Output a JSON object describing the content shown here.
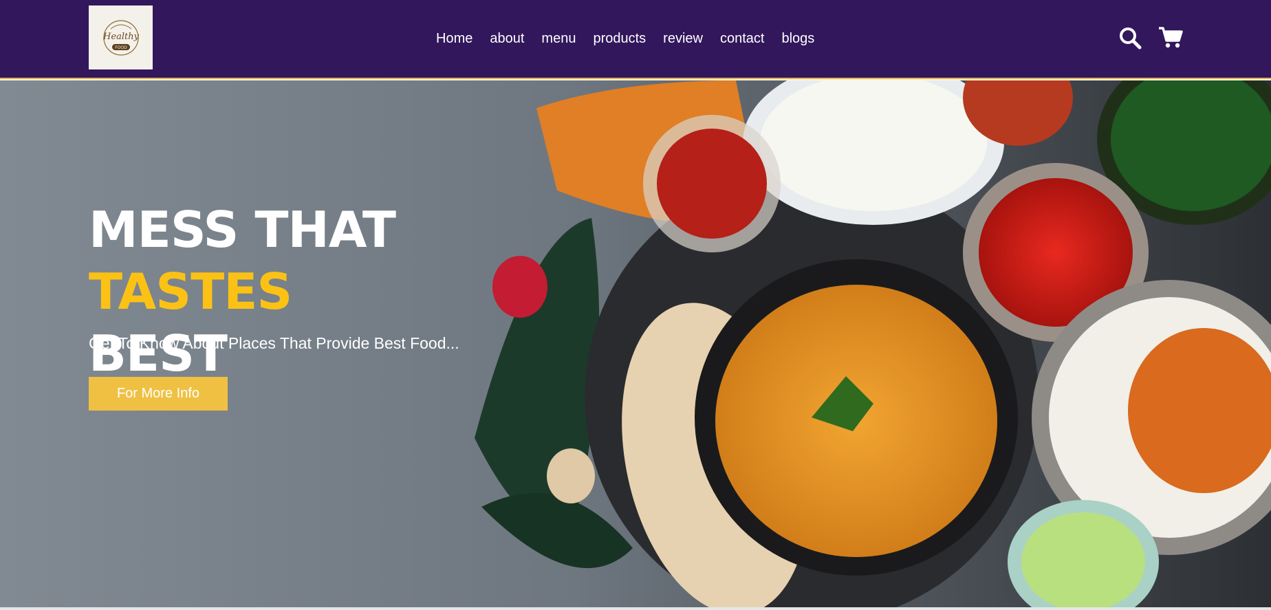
{
  "brand": {
    "logo_text_top": "Healthy",
    "logo_text_bottom": "FOOD"
  },
  "nav": {
    "items": [
      {
        "label": "Home"
      },
      {
        "label": "about"
      },
      {
        "label": "menu"
      },
      {
        "label": "products"
      },
      {
        "label": "review"
      },
      {
        "label": "contact"
      },
      {
        "label": "blogs"
      }
    ]
  },
  "header_icons": [
    "search-icon",
    "cart-icon"
  ],
  "hero": {
    "title_part1": "MESS THAT ",
    "title_accent": "TASTES",
    "title_part2": "BEST",
    "subtitle": "Get To Know About Places That Provide Best Food...",
    "button_label": "For More Info"
  },
  "colors": {
    "header_bg": "#32175c",
    "accent_yellow": "#fbc215",
    "button_bg": "#efc042",
    "hero_bg": "#7f8890"
  }
}
